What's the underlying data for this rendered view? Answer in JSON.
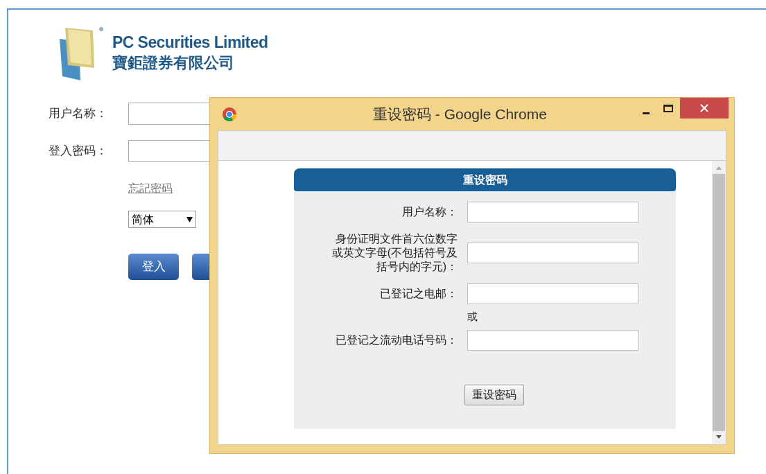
{
  "brand": {
    "name": "PC Securities Limited",
    "name_zh": "寶鉅證券有限公司"
  },
  "login": {
    "fields": [
      {
        "label": "用户名称："
      },
      {
        "label": "登入密码："
      }
    ],
    "forgot_link": "忘記密码",
    "language": "简体",
    "buttons": [
      {
        "label": "登入",
        "covered": false
      },
      {
        "covered": true
      }
    ]
  },
  "popup": {
    "window_title": "重设密码 - Google Chrome",
    "form_title": "重设密码",
    "fields": [
      {
        "kind": "field",
        "label": "用户名称："
      },
      {
        "kind": "field",
        "label": "身份证明文件首六位数字或英文字母(不包括符号及括号内的字元)："
      },
      {
        "kind": "field",
        "label": "已登记之电邮："
      },
      {
        "kind": "separator",
        "label": "或"
      },
      {
        "kind": "field",
        "label": "已登记之流动电话号码："
      }
    ],
    "submit": "重设密码"
  }
}
